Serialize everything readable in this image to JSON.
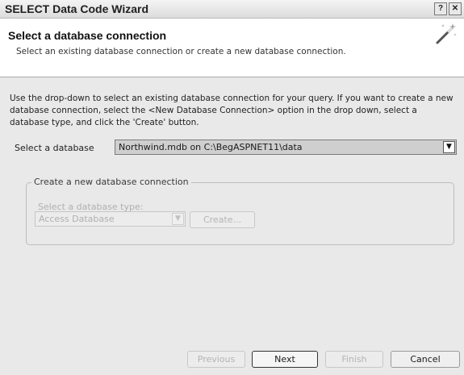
{
  "window": {
    "title": "SELECT Data Code Wizard",
    "help_glyph": "?",
    "close_glyph": "✕"
  },
  "header": {
    "title": "Select a database connection",
    "subtitle": "Select an existing database connection or create a new database connection.",
    "icon": "wizard-wand-icon"
  },
  "intro_text": "Use the drop-down to select an existing database connection for your query.  If you want to create a new database connection, select the <New Database Connection> option in the drop down, select a database type, and click the 'Create' button.",
  "database": {
    "label": "Select a database",
    "selected": "Northwind.mdb on C:\\BegASPNET11\\data",
    "arrow": "▼"
  },
  "new_connection": {
    "legend": "Create a new database connection",
    "type_label": "Select a database type:",
    "type_selected": "Access Database",
    "arrow": "▼",
    "create_label": "Create..."
  },
  "footer": {
    "previous_label": "Previous",
    "next_label": "Next",
    "finish_label": "Finish",
    "cancel_label": "Cancel"
  },
  "colors": {
    "window_bg": "#e9e9e9",
    "header_bg": "#ffffff",
    "selected_field_bg": "#cfcfcf",
    "disabled_text": "#b0b0b0"
  }
}
